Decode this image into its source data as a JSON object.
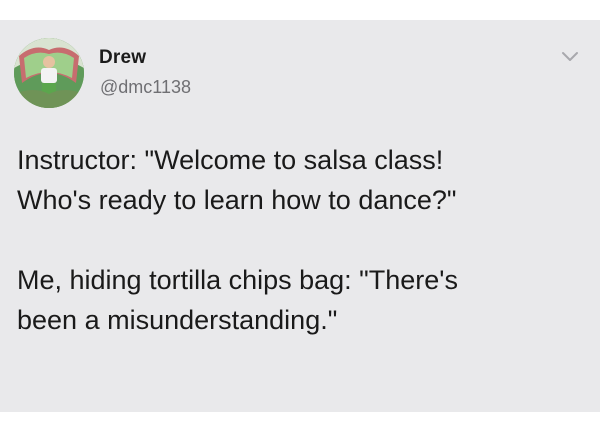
{
  "tweet": {
    "author_name": "Drew",
    "author_handle": "@dmc1138",
    "avatar_icon": "user-avatar-icon",
    "menu_icon": "chevron-down-icon",
    "lines": [
      "Instructor: \"Welcome to salsa class!",
      "Who's ready to learn how to dance?\"",
      "Me, hiding tortilla chips bag: \"There's",
      "been a misunderstanding.\""
    ]
  },
  "colors": {
    "card_background": "#e9e9eb",
    "name_text": "#1b1b1b",
    "handle_text": "#6f6f73",
    "body_text": "#1a1a1a",
    "chevron": "#a8a8ad"
  }
}
